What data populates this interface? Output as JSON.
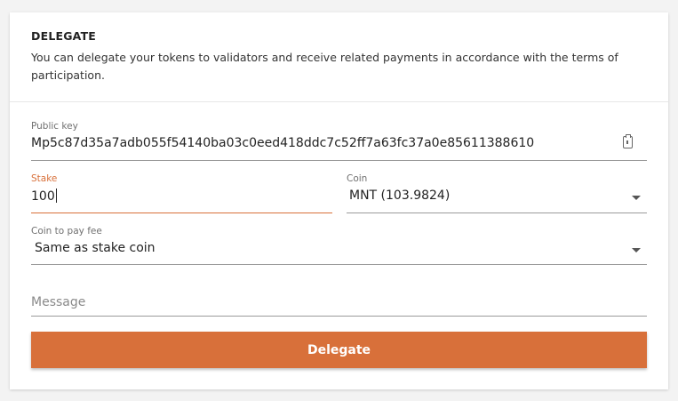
{
  "header": {
    "title": "DELEGATE",
    "description": "You can delegate your tokens to validators and receive related payments in accordance with the terms of participation."
  },
  "form": {
    "public_key": {
      "label": "Public key",
      "value": "Mp5c87d35a7adb055f54140ba03c0eed418ddc7c52ff7a63fc37a0e85611388610"
    },
    "stake": {
      "label": "Stake",
      "value": "100"
    },
    "coin": {
      "label": "Coin",
      "value": "MNT (103.9824)"
    },
    "fee_coin": {
      "label": "Coin to pay fee",
      "value": "Same as stake coin"
    },
    "message": {
      "placeholder": "Message",
      "value": ""
    },
    "submit_label": "Delegate"
  },
  "colors": {
    "accent": "#d8703a",
    "background": "#f3f3f3",
    "card": "#ffffff"
  },
  "icons": {
    "paste": "clipboard-paste-icon",
    "dropdown": "chevron-down-icon"
  }
}
